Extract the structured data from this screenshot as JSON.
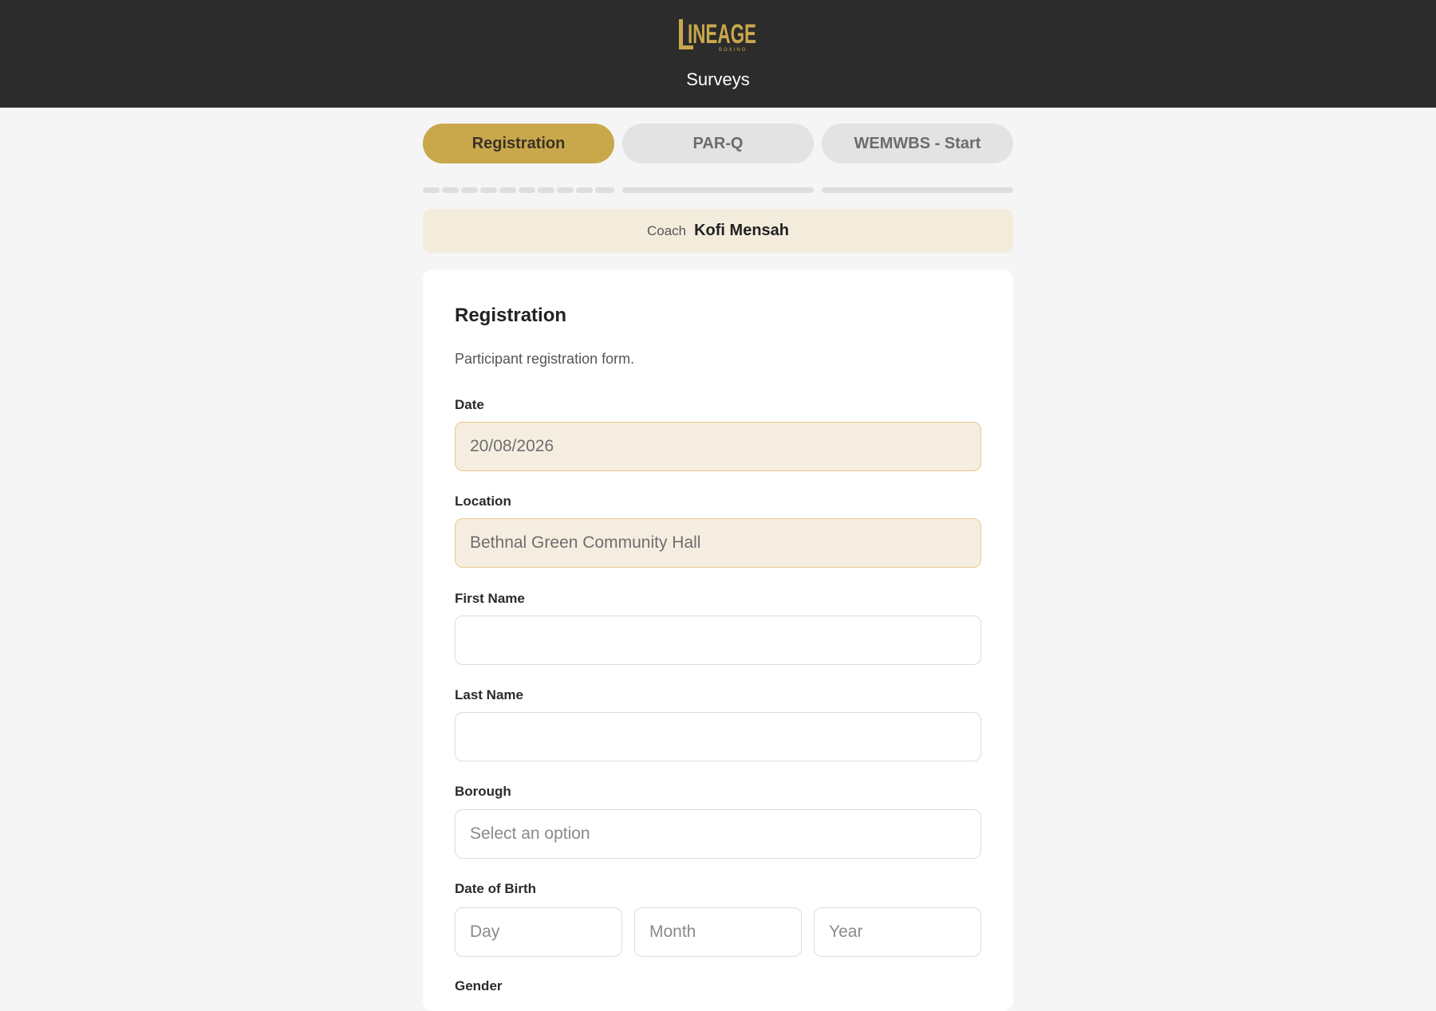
{
  "header": {
    "logo_text": "LINEAGE",
    "logo_subtext": "BOXING",
    "title": "Surveys"
  },
  "tabs": [
    {
      "label": "Registration",
      "active": true
    },
    {
      "label": "PAR-Q",
      "active": false
    },
    {
      "label": "WEMWBS - Start",
      "active": false
    }
  ],
  "coach": {
    "label": "Coach",
    "name": "Kofi Mensah"
  },
  "form": {
    "title": "Registration",
    "description": "Participant registration form.",
    "date": {
      "label": "Date",
      "value": "20/08/2026"
    },
    "location": {
      "label": "Location",
      "value": "Bethnal Green Community Hall"
    },
    "first_name": {
      "label": "First Name",
      "value": ""
    },
    "last_name": {
      "label": "Last Name",
      "value": ""
    },
    "borough": {
      "label": "Borough",
      "placeholder": "Select an option"
    },
    "dob": {
      "label": "Date of Birth",
      "day_placeholder": "Day",
      "month_placeholder": "Month",
      "year_placeholder": "Year"
    },
    "gender": {
      "label": "Gender"
    }
  },
  "colors": {
    "header_bg": "#2c2c2c",
    "accent_gold": "#c9a84c",
    "coach_bg": "#f3ecdd",
    "prefilled_bg": "#f5eee0"
  }
}
